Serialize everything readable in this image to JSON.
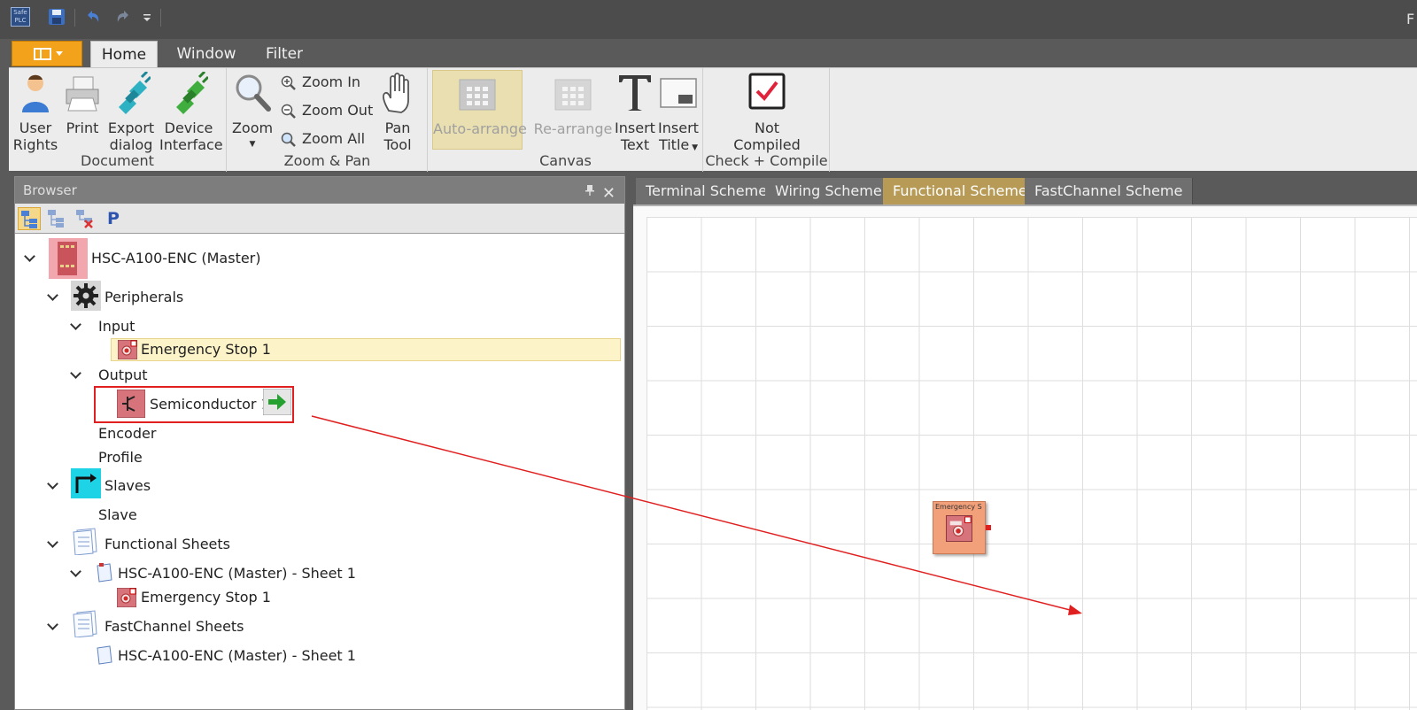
{
  "titlebar": {
    "title_fragment": "F",
    "app_icon_text": "Safe PLC"
  },
  "ribbon": {
    "tabs": [
      "Home",
      "Window",
      "Filter"
    ],
    "active_tab": "Home",
    "groups": {
      "document": {
        "title": "Document",
        "buttons": {
          "user_rights": [
            "User",
            "Rights"
          ],
          "print": "Print",
          "export_dialog": [
            "Export",
            "dialog"
          ],
          "device_interface": [
            "Device",
            "Interface"
          ]
        }
      },
      "zoom_pan": {
        "title": "Zoom & Pan",
        "zoom": "Zoom",
        "zoom_in": "Zoom In",
        "zoom_out": "Zoom Out",
        "zoom_all": "Zoom All",
        "pan_tool": [
          "Pan",
          "Tool"
        ]
      },
      "canvas": {
        "title": "Canvas",
        "auto_arrange": "Auto-arrange",
        "re_arrange": "Re-arrange",
        "insert_text": [
          "Insert",
          "Text"
        ],
        "insert_title": [
          "Insert",
          "Title"
        ]
      },
      "check_compile": {
        "title": "Check + Compile",
        "status": [
          "Not",
          "Compiled"
        ]
      }
    }
  },
  "browser": {
    "title": "Browser",
    "toolbar_p": "P",
    "tree": {
      "master": "HSC-A100-ENC (Master)",
      "peripherals": "Peripherals",
      "input": "Input",
      "input_item": "Emergency Stop 1",
      "output": "Output",
      "output_item": "Semiconductor 1",
      "encoder": "Encoder",
      "profile": "Profile",
      "slaves": "Slaves",
      "slave": "Slave",
      "functional_sheets": "Functional Sheets",
      "functional_sheet_1": "HSC-A100-ENC (Master) - Sheet 1",
      "functional_sheet_item": "Emergency Stop 1",
      "fastchannel_sheets": "FastChannel Sheets",
      "fastchannel_sheet_1": "HSC-A100-ENC (Master) - Sheet 1"
    }
  },
  "document": {
    "tabs": [
      "Terminal Scheme",
      "Wiring Scheme",
      "Functional Scheme",
      "FastChannel Scheme"
    ],
    "active_tab": "Functional Scheme",
    "canvas_node_label": "Emergency S"
  },
  "colors": {
    "accent_orange": "#f2a21b",
    "active_tab": "#b79a55",
    "selection_highlight": "#fdf3c8",
    "annotation_red": "#e02020"
  }
}
